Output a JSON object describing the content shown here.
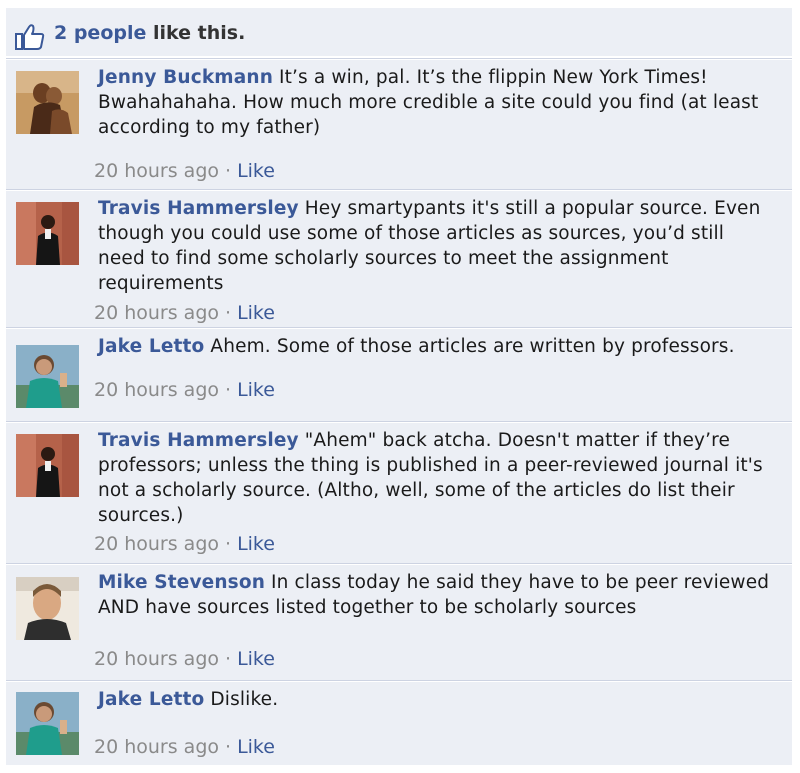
{
  "likes": {
    "count_label": "2 people",
    "suffix": " like this."
  },
  "comments": [
    {
      "author": "Jenny Buckmann",
      "text": "It’s a win, pal. It’s the flippin New York Times! Bwahahahaha. How much more credible a site could you find (at least according to my father)",
      "time": "20 hours ago",
      "like_label": "Like"
    },
    {
      "author": "Travis Hammersley",
      "text": "Hey smartypants it's still a popular source. Even though you could use some of those articles as sources, you’d still need to find some scholarly sources to meet the assignment requirements",
      "time": "20 hours ago",
      "like_label": "Like"
    },
    {
      "author": "Jake Letto",
      "text": "Ahem. Some of those articles are written by professors.",
      "time": "20 hours ago",
      "like_label": "Like"
    },
    {
      "author": "Travis Hammersley",
      "text": "\"Ahem\" back atcha. Doesn't matter if they’re professors; unless the thing is published in a peer-reviewed journal it's not a scholarly source. (Altho, well, some of the articles do list their sources.)",
      "time": "20 hours ago",
      "like_label": "Like"
    },
    {
      "author": "Mike Stevenson",
      "text": "In class today he said they have to be peer reviewed AND have sources listed together to be scholarly sources",
      "time": "20 hours ago",
      "like_label": "Like"
    },
    {
      "author": "Jake Letto",
      "text": "Dislike.",
      "time": "20 hours ago",
      "like_label": "Like"
    }
  ],
  "meta_separator": "·",
  "colors": {
    "panel_bg": "#eceff5",
    "link_blue": "#3b5998",
    "timestamp_gray": "#8a8a8a",
    "divider": "#cdd3e2"
  }
}
